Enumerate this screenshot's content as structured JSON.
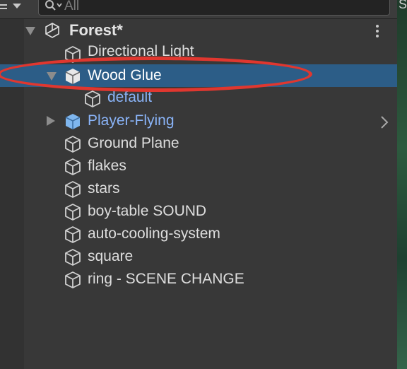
{
  "search": {
    "placeholder": "All"
  },
  "scene": {
    "name": "Forest*"
  },
  "hierarchy": {
    "items": [
      {
        "label": "Directional Light",
        "kind": "object"
      },
      {
        "label": "Wood Glue",
        "kind": "prefab-instance",
        "selected": true,
        "expanded": true
      },
      {
        "label": "default",
        "kind": "object",
        "indent": 1
      },
      {
        "label": "Player-Flying",
        "kind": "prefab",
        "collapsed": true
      },
      {
        "label": "Ground Plane",
        "kind": "object"
      },
      {
        "label": "flakes",
        "kind": "object"
      },
      {
        "label": "stars",
        "kind": "object"
      },
      {
        "label": "boy-table SOUND",
        "kind": "object"
      },
      {
        "label": "auto-cooling-system",
        "kind": "object"
      },
      {
        "label": "square",
        "kind": "object"
      },
      {
        "label": "ring - SCENE CHANGE",
        "kind": "object"
      }
    ]
  },
  "colors": {
    "selection": "#2c5d87",
    "prefab_text": "#8ab4f8",
    "annotation": "#e0372f"
  },
  "icons": [
    "menu-icon",
    "dropdown-caret-icon",
    "search-icon",
    "unity-scene-icon",
    "cube-icon",
    "prefab-cube-icon",
    "kebab-menu-icon",
    "chevron-right-icon"
  ]
}
